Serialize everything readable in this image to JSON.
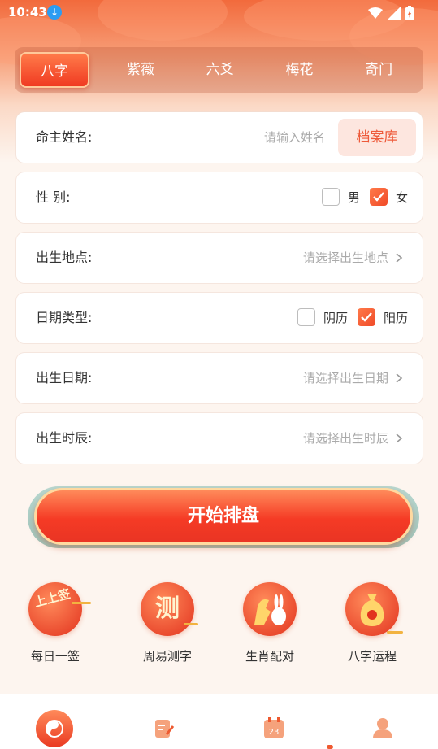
{
  "status_bar": {
    "time": "10:43"
  },
  "tabs": [
    {
      "label": "八字",
      "active": true
    },
    {
      "label": "紫薇",
      "active": false
    },
    {
      "label": "六爻",
      "active": false
    },
    {
      "label": "梅花",
      "active": false
    },
    {
      "label": "奇门",
      "active": false
    }
  ],
  "form": {
    "name": {
      "label": "命主姓名:",
      "placeholder": "请输入姓名",
      "archive_button": "档案库"
    },
    "gender": {
      "label": "性  别:",
      "options": [
        {
          "label": "男",
          "checked": false
        },
        {
          "label": "女",
          "checked": true
        }
      ]
    },
    "birth_place": {
      "label": "出生地点:",
      "placeholder": "请选择出生地点"
    },
    "date_type": {
      "label": "日期类型:",
      "options": [
        {
          "label": "阴历",
          "checked": false
        },
        {
          "label": "阳历",
          "checked": true
        }
      ]
    },
    "birth_date": {
      "label": "出生日期:",
      "placeholder": "请选择出生日期"
    },
    "birth_hour": {
      "label": "出生时辰:",
      "placeholder": "请选择出生时辰"
    }
  },
  "start_button": "开始排盘",
  "features": [
    {
      "label": "每日一签",
      "badge": "上上签",
      "icon": "lottery-stick-icon"
    },
    {
      "label": "周易测字",
      "badge": "测",
      "icon": "character-test-icon"
    },
    {
      "label": "生肖配对",
      "badge": "",
      "icon": "zodiac-pair-icon"
    },
    {
      "label": "八字运程",
      "badge": "",
      "icon": "money-bag-icon"
    }
  ],
  "bottom_nav": [
    {
      "icon": "yin-yang-icon",
      "active": true
    },
    {
      "icon": "notes-icon",
      "active": false
    },
    {
      "icon": "calendar-icon",
      "badge_text": "23",
      "active": false
    },
    {
      "icon": "user-icon",
      "active": false
    }
  ],
  "colors": {
    "accent": "#f04a28",
    "accent_light": "#fde6df",
    "background": "#fdf5ef"
  }
}
